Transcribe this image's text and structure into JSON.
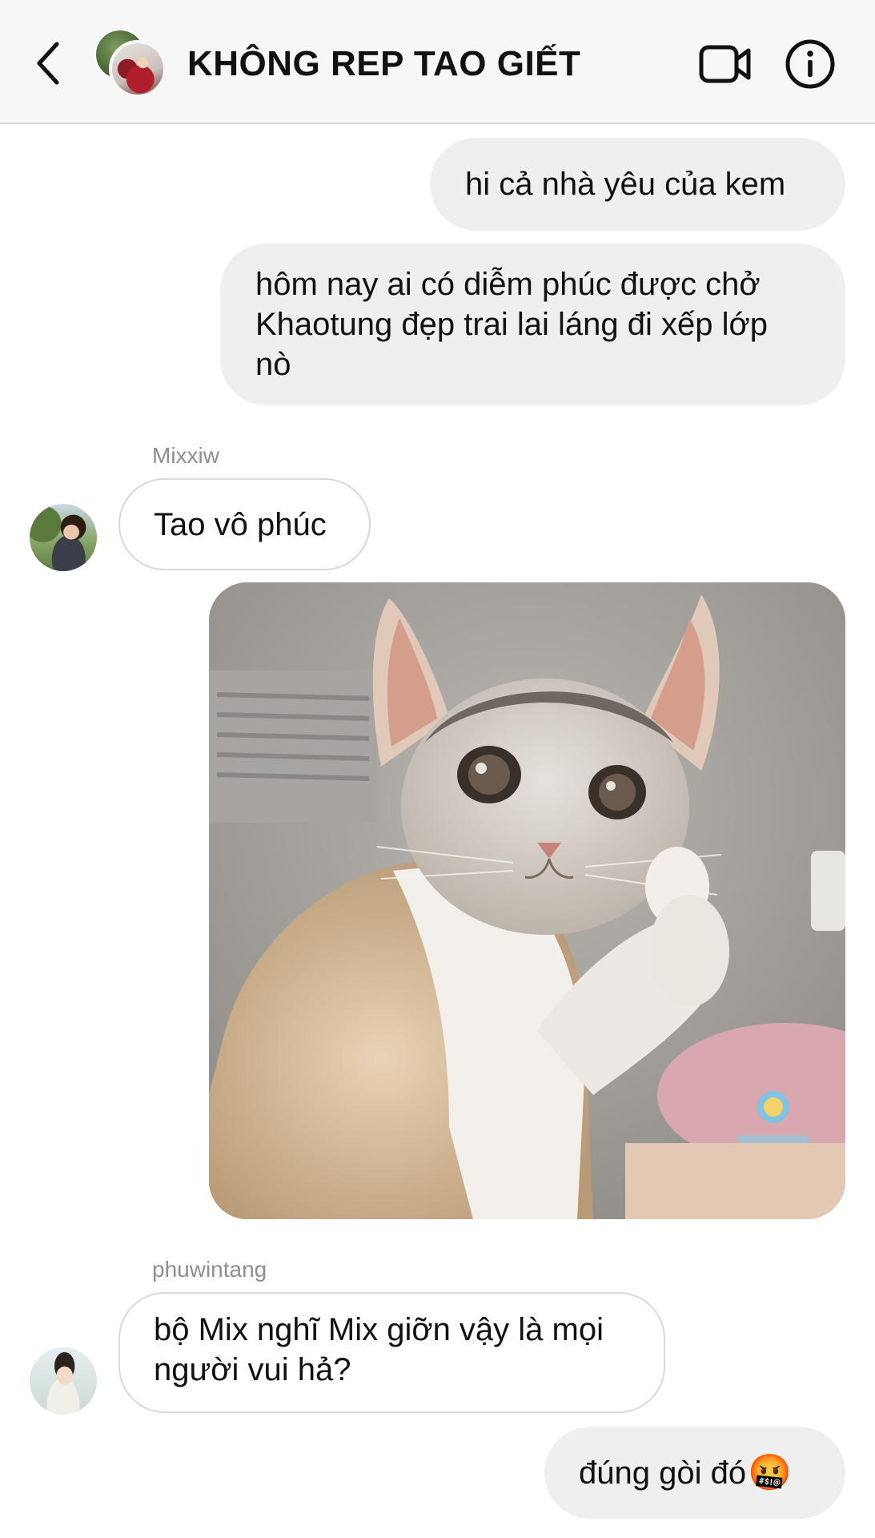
{
  "header": {
    "title": "KHÔNG REP TAO GIẾT",
    "back_icon": "chevron-left-icon",
    "video_icon": "video-camera-icon",
    "info_icon": "info-icon"
  },
  "messages": [
    {
      "type": "outgoing",
      "text": "hi cả nhà yêu của kem"
    },
    {
      "type": "outgoing",
      "lines": [
        "hôm nay ai có diễm phúc được chở",
        "Khaotung đẹp trai lai láng đi xếp lớp",
        "nò"
      ]
    },
    {
      "type": "incoming",
      "sender": "Mixxiw",
      "text": "Tao vô phúc"
    },
    {
      "type": "outgoing-image",
      "description_icon": "cat-photo"
    },
    {
      "type": "incoming",
      "sender": "phuwintang",
      "lines": [
        "bộ Mix nghĩ Mix giỡn vậy là mọi",
        "người vui hả?"
      ]
    },
    {
      "type": "outgoing",
      "text": "đúng gòi đó",
      "emoji": "🤬"
    }
  ],
  "colors": {
    "header_bg": "#f7f7f7",
    "outgoing_bubble": "#efefef",
    "incoming_border": "#d9d9d9",
    "sender_name": "#8e8e8e"
  }
}
